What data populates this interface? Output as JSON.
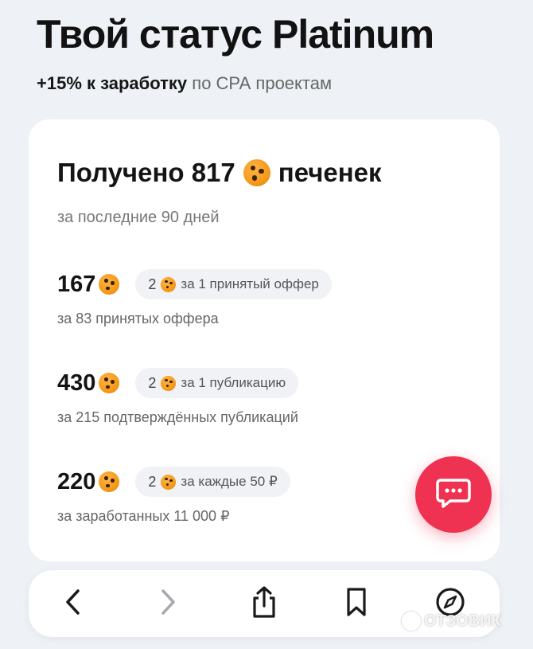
{
  "header": {
    "title": "Твой статус Platinum",
    "subtitle_bold": "+15% к заработку",
    "subtitle_rest": " по СРА проектам"
  },
  "card": {
    "title_prefix": "Получено 817",
    "title_suffix": "печенек",
    "period": "за последние 90 дней",
    "rows": [
      {
        "amount": "167",
        "rate_num": "2",
        "rate_text": "за 1 принятый оффер",
        "desc": "за 83 принятых оффера"
      },
      {
        "amount": "430",
        "rate_num": "2",
        "rate_text": "за 1 публикацию",
        "desc": "за 215 подтверждённых публикаций"
      },
      {
        "amount": "220",
        "rate_num": "2",
        "rate_text": "за каждые 50 ₽",
        "desc": "за заработанных 11 000 ₽"
      }
    ]
  },
  "icons": {
    "cookie": "cookie-icon",
    "chat": "chat-bubble-icon",
    "back": "chevron-left-icon",
    "forward": "chevron-right-icon",
    "share": "share-icon",
    "bookmark": "bookmark-icon",
    "compass": "compass-icon"
  },
  "colors": {
    "background": "#eef1f6",
    "accent": "#ef3152",
    "cookie": "#f59a1b"
  },
  "watermark": "ОТЗОВИК"
}
